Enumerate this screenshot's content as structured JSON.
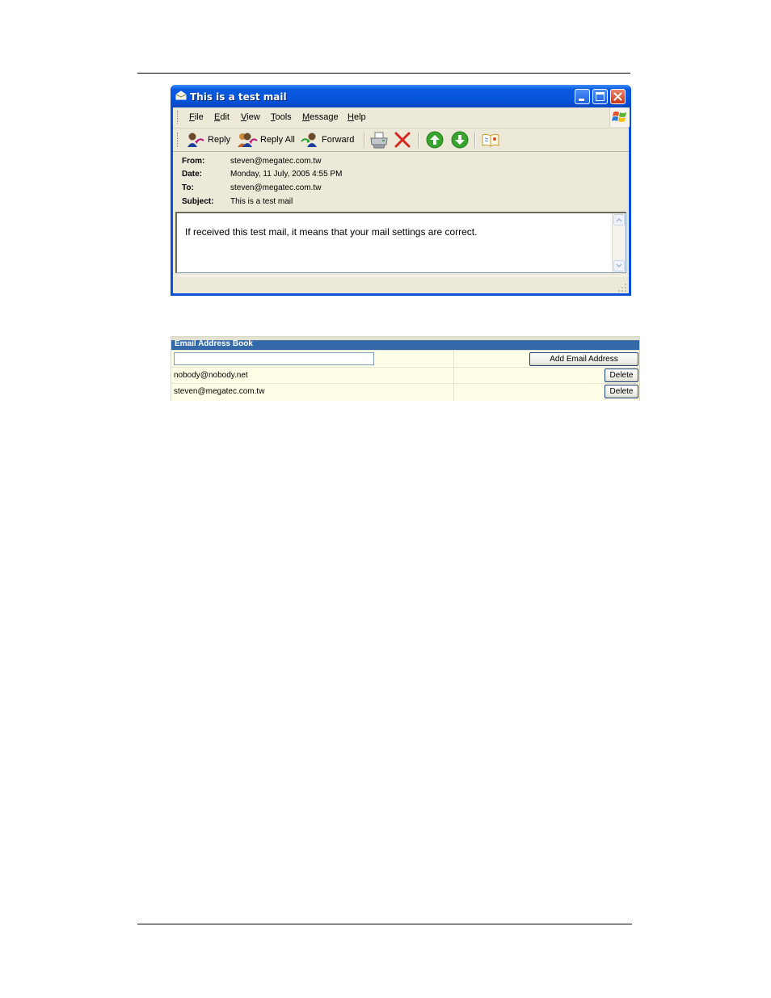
{
  "window": {
    "title": "This is a test mail",
    "menu": [
      "File",
      "Edit",
      "View",
      "Tools",
      "Message",
      "Help"
    ],
    "toolbar": {
      "reply": "Reply",
      "reply_all": "Reply All",
      "forward": "Forward"
    },
    "headers": [
      {
        "label": "From:",
        "value": "steven@megatec.com.tw"
      },
      {
        "label": "Date:",
        "value": "Monday, 11 July, 2005 4:55 PM"
      },
      {
        "label": "To:",
        "value": "steven@megatec.com.tw"
      },
      {
        "label": "Subject:",
        "value": "This is a test mail"
      }
    ],
    "body": "If received this test mail, it means that your mail settings are correct."
  },
  "address_book": {
    "title": "Email Address Book",
    "input_value": "",
    "add_label": "Add Email Address",
    "entries": [
      {
        "email": "nobody@nobody.net",
        "delete_label": "Delete"
      },
      {
        "email": "steven@megatec.com.tw",
        "delete_label": "Delete"
      }
    ]
  },
  "colors": {
    "titlebar": "#0653d8",
    "window_bg": "#ece9d8",
    "address_book_header": "#346aa8",
    "address_book_row": "#fffee7"
  }
}
